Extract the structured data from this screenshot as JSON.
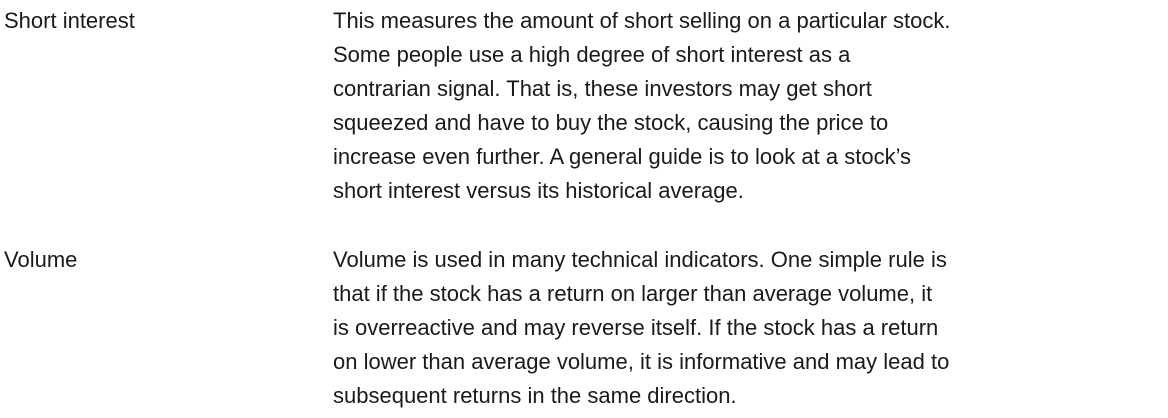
{
  "entries": [
    {
      "term": "Short interest",
      "definition_lines": [
        "This measures the amount of short selling on a particular stock.",
        "Some people use a high degree of short interest as a",
        "contrarian signal. That is, these investors may get short",
        "squeezed and have to buy the stock, causing the price to",
        "increase even further. A general guide is to look at a stock’s",
        "short interest versus its historical average."
      ]
    },
    {
      "term": "Volume",
      "definition_lines": [
        "Volume is used in many technical indicators. One simple rule is",
        "that if the stock has a return on larger than average volume, it",
        "is overreactive and may reverse itself. If the stock has a return",
        "on lower than average volume, it is informative and may lead to",
        "subsequent returns in the same direction."
      ]
    }
  ]
}
